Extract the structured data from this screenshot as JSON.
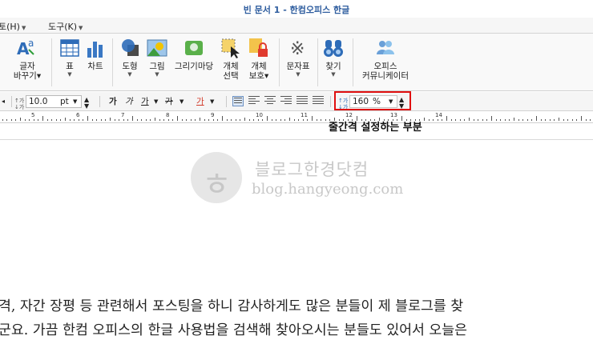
{
  "window": {
    "title": "빈 문서 1 - 한컴오피스 한글"
  },
  "menu": [
    {
      "label": "토(H)"
    },
    {
      "label": "도구(K)"
    }
  ],
  "ribbon": {
    "items": [
      {
        "label1": "글자",
        "label2": "바꾸기",
        "icon": "char-change-icon"
      },
      {
        "label1": "표",
        "label2": "",
        "icon": "table-icon"
      },
      {
        "label1": "차트",
        "label2": "",
        "icon": "chart-icon"
      },
      {
        "label1": "도형",
        "label2": "",
        "icon": "shape-icon"
      },
      {
        "label1": "그림",
        "label2": "",
        "icon": "picture-icon"
      },
      {
        "label1": "그리기마당",
        "label2": "",
        "icon": "drawing-gallery-icon"
      },
      {
        "label1": "개체",
        "label2": "선택",
        "icon": "object-select-icon"
      },
      {
        "label1": "개체",
        "label2": "보호",
        "icon": "object-protect-icon"
      },
      {
        "label1": "문자표",
        "label2": "",
        "icon": "symbol-icon"
      },
      {
        "label1": "찾기",
        "label2": "",
        "icon": "find-icon"
      },
      {
        "label1": "오피스",
        "label2": "커뮤니케이터",
        "icon": "office-communicator-icon"
      }
    ]
  },
  "format": {
    "font_size": "10.0",
    "font_unit": "pt",
    "bold": "가",
    "italic": "가",
    "underline": "가",
    "strike": "가",
    "color": "가",
    "line_spacing_value": "160",
    "line_spacing_unit": "%"
  },
  "ruler": {
    "numbers": [
      "5",
      "6",
      "7",
      "8",
      "9",
      "10",
      "11",
      "12",
      "13",
      "14"
    ]
  },
  "callout": "줄간격 설정하는 부분",
  "watermark": {
    "title": "블로그한경닷컴",
    "url": "blog.hangyeong.com"
  },
  "document": {
    "lines": [
      "격, 자간 장평 등 관련해서 포스팅을 하니 감사하게도 많은 분들이 제 블로그를 찾",
      "군요. 가끔 한컴 오피스의 한글 사용법을 검색해 찾아오시는 분들도 있어서 오늘은"
    ]
  },
  "colors": {
    "title": "#2d5c9e",
    "highlight": "#e01010",
    "chart": "#3a78c4"
  }
}
